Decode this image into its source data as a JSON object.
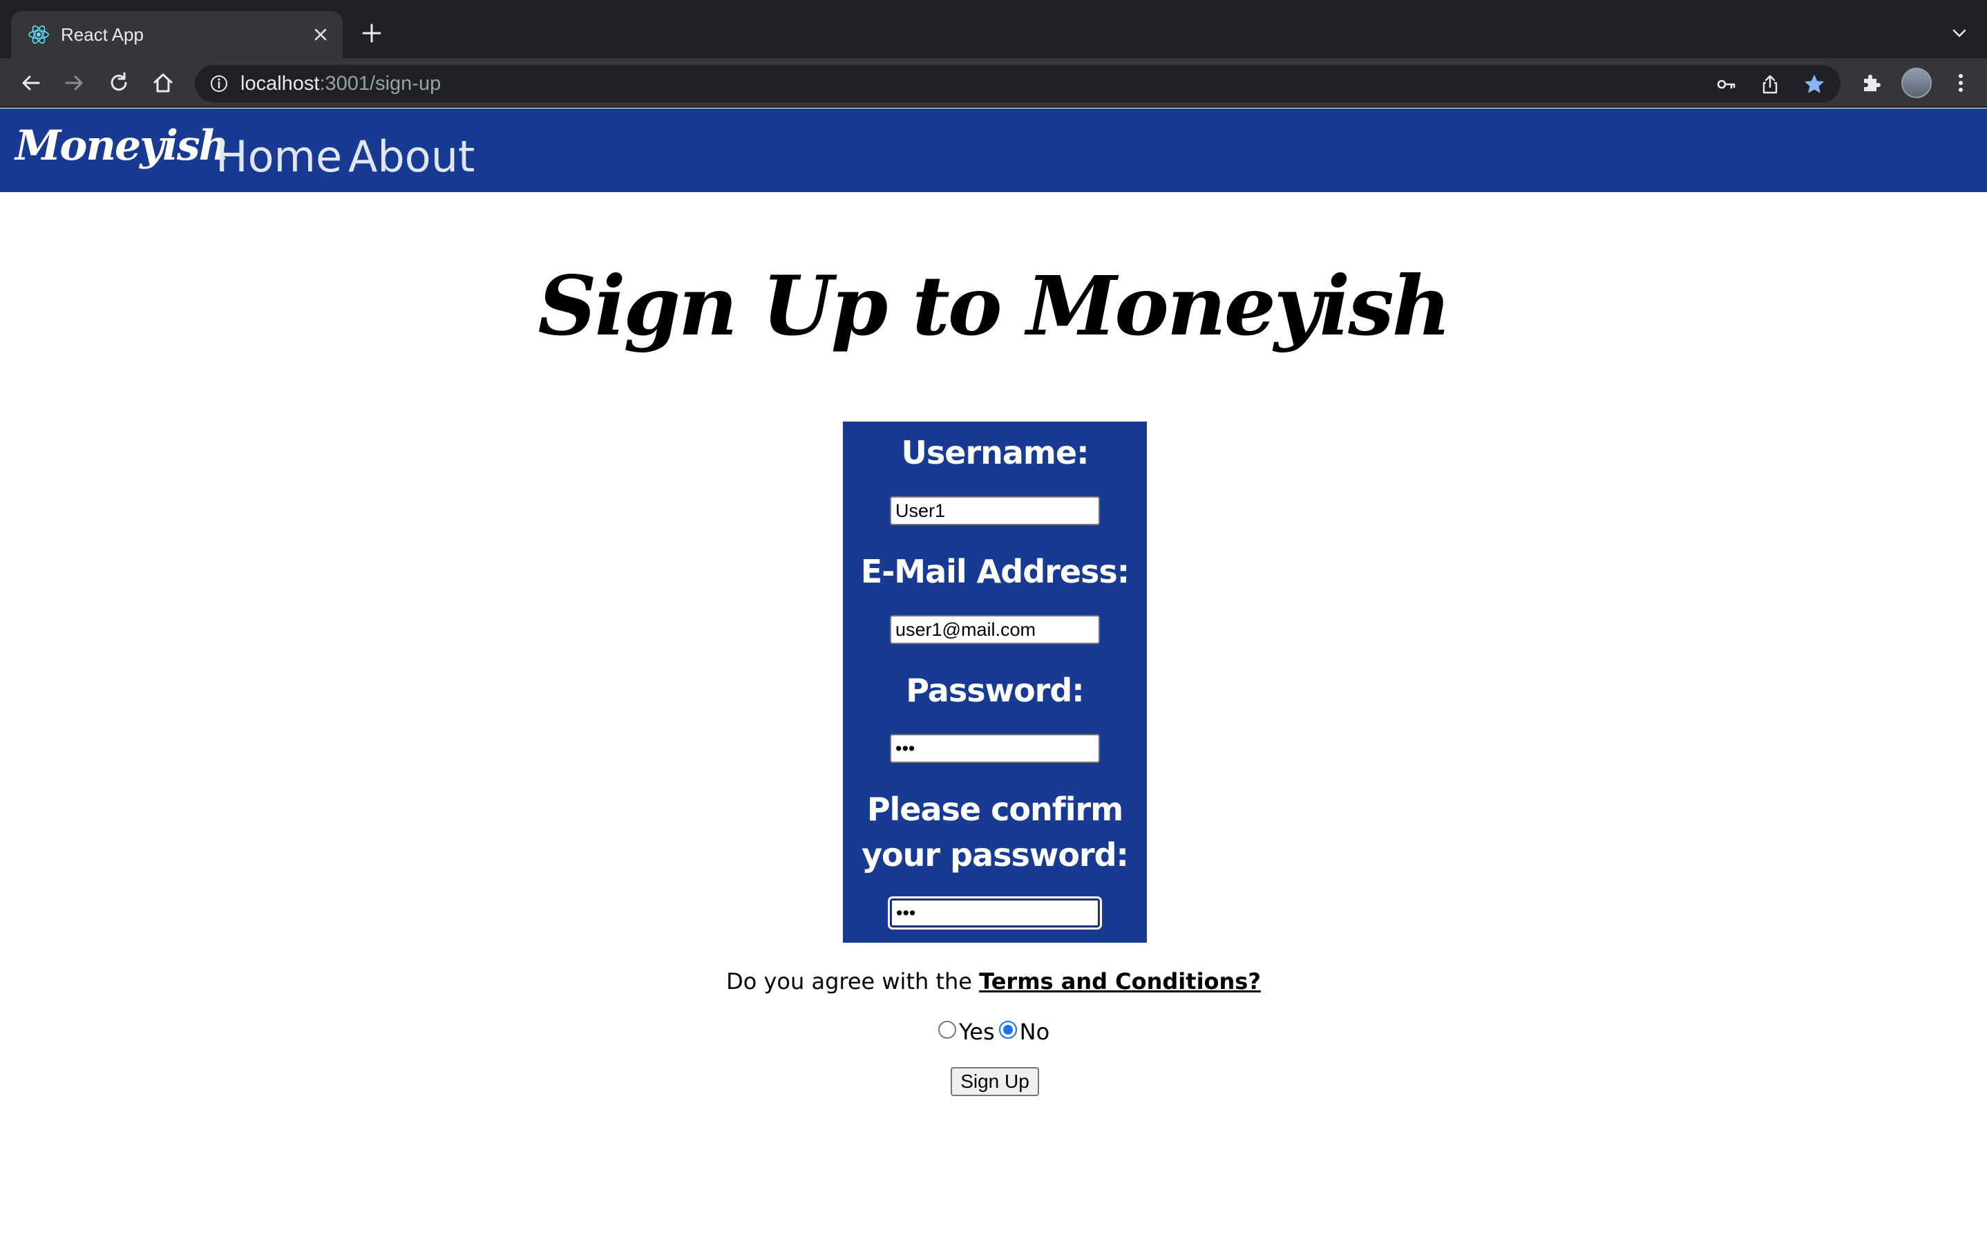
{
  "browser": {
    "tab_title": "React App",
    "url_host": "localhost",
    "url_path": ":3001/sign-up"
  },
  "navbar": {
    "brand": "Moneyish",
    "links": [
      "Home",
      "About"
    ],
    "background_color": "#183a93"
  },
  "page": {
    "title": "Sign Up to Moneyish"
  },
  "form": {
    "username_label": "Username:",
    "username_value": "User1",
    "email_label": "E-Mail Address:",
    "email_value": "user1@mail.com",
    "password_label": "Password:",
    "password_value": "•••",
    "confirm_label_line1": "Please confirm",
    "confirm_label_line2": "your password:",
    "confirm_value": "•••"
  },
  "terms": {
    "question": "Do you agree with the",
    "link": "Terms and Conditions?",
    "options": [
      "Yes",
      "No"
    ],
    "selected": "No"
  },
  "submit_label": "Sign Up"
}
